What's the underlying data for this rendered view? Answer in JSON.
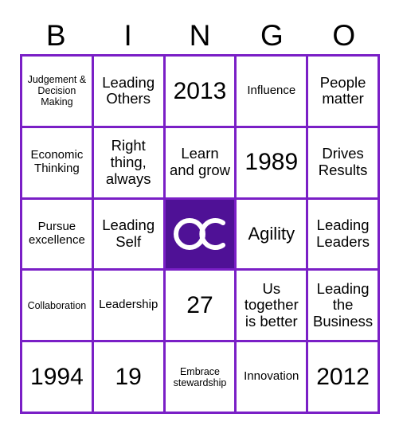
{
  "card": {
    "header_letters": [
      "B",
      "I",
      "N",
      "G",
      "O"
    ],
    "colors": {
      "border_purple": "#7A1FC6",
      "free_space_purple": "#4F1196",
      "text": "#000000",
      "background": "#FFFFFF",
      "logo": "#FFFFFF"
    },
    "grid": {
      "rows": 5,
      "columns": 5,
      "cells": [
        [
          {
            "text": "Judgement & Decision Making",
            "size": "xs",
            "free": false
          },
          {
            "text": "Leading Others",
            "size": "md",
            "free": false
          },
          {
            "text": "2013",
            "size": "xl",
            "free": false
          },
          {
            "text": "Influence",
            "size": "sm",
            "free": false
          },
          {
            "text": "People matter",
            "size": "md",
            "free": false
          }
        ],
        [
          {
            "text": "Economic Thinking",
            "size": "sm",
            "free": false
          },
          {
            "text": "Right thing, always",
            "size": "md",
            "free": false
          },
          {
            "text": "Learn and grow",
            "size": "md",
            "free": false
          },
          {
            "text": "1989",
            "size": "xl",
            "free": false
          },
          {
            "text": "Drives Results",
            "size": "md",
            "free": false
          }
        ],
        [
          {
            "text": "Pursue excellence",
            "size": "sm",
            "free": false
          },
          {
            "text": "Leading Self",
            "size": "md",
            "free": false
          },
          {
            "text": "",
            "size": "md",
            "free": true,
            "icon": "cc-logo-icon"
          },
          {
            "text": "Agility",
            "size": "lg",
            "free": false
          },
          {
            "text": "Leading Leaders",
            "size": "md",
            "free": false
          }
        ],
        [
          {
            "text": "Collaboration",
            "size": "xs",
            "free": false
          },
          {
            "text": "Leadership",
            "size": "sm",
            "free": false
          },
          {
            "text": "27",
            "size": "xl",
            "free": false
          },
          {
            "text": "Us together is better",
            "size": "md",
            "free": false
          },
          {
            "text": "Leading the Business",
            "size": "md",
            "free": false
          }
        ],
        [
          {
            "text": "1994",
            "size": "xl",
            "free": false
          },
          {
            "text": "19",
            "size": "xl",
            "free": false
          },
          {
            "text": "Embrace stewardship",
            "size": "xs",
            "free": false
          },
          {
            "text": "Innovation",
            "size": "sm",
            "free": false
          },
          {
            "text": "2012",
            "size": "xl",
            "free": false
          }
        ]
      ]
    }
  }
}
